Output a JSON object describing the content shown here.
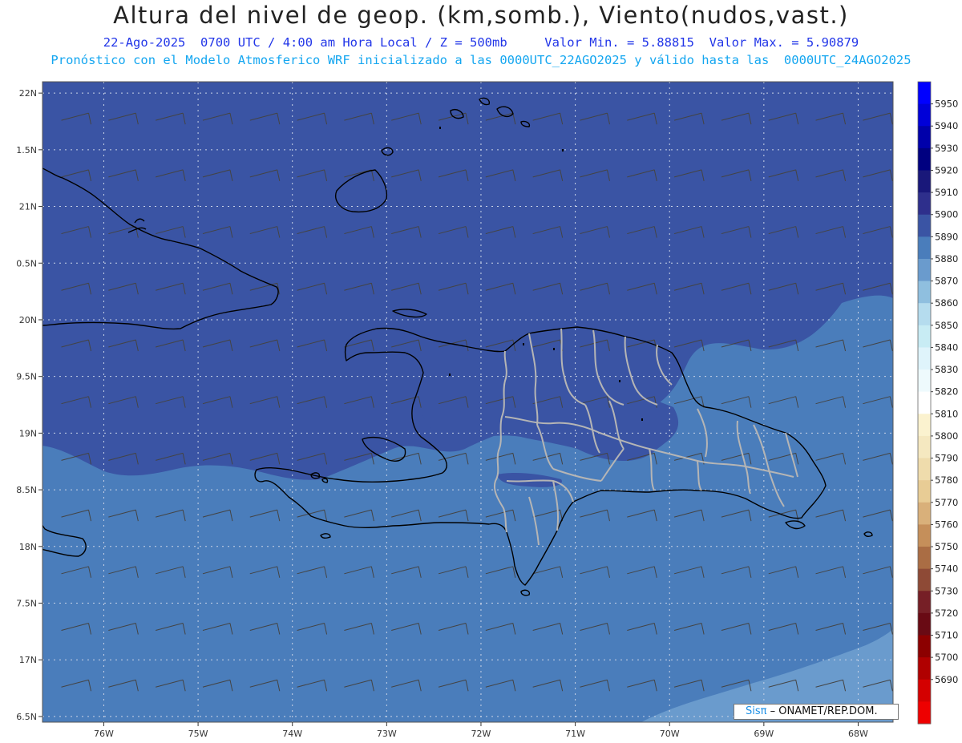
{
  "title": "Altura del nivel de geop. (km,somb.), Viento(nudos,vast.)",
  "subtitle_line1": "22-Ago-2025  0700 UTC / 4:00 am Hora Local / Z = 500mb     Valor Min. = 5.88815  Valor Max. = 5.90879",
  "subtitle_line2": "Pronóstico con el Modelo Atmosferico WRF inicializado a las 0000UTC_22AGO2025 y válido hasta las  0000UTC_24AGO2025",
  "credit": {
    "brand": "Sisπ",
    "text": " – ONAMET/REP.DOM."
  },
  "map": {
    "lon_range": [
      -76.65,
      -67.63
    ],
    "lat_range": [
      16.45,
      22.1
    ],
    "lat_ticks": [
      {
        "value": 22.0,
        "label": "22N"
      },
      {
        "value": 21.5,
        "label": "1.5N"
      },
      {
        "value": 21.0,
        "label": "21N"
      },
      {
        "value": 20.5,
        "label": "0.5N"
      },
      {
        "value": 20.0,
        "label": "20N"
      },
      {
        "value": 19.5,
        "label": "9.5N"
      },
      {
        "value": 19.0,
        "label": "19N"
      },
      {
        "value": 18.5,
        "label": "8.5N"
      },
      {
        "value": 18.0,
        "label": "18N"
      },
      {
        "value": 17.5,
        "label": "7.5N"
      },
      {
        "value": 17.0,
        "label": "17N"
      },
      {
        "value": 16.5,
        "label": "6.5N"
      }
    ],
    "lon_ticks": [
      {
        "value": -76,
        "label": "76W"
      },
      {
        "value": -75,
        "label": "75W"
      },
      {
        "value": -74,
        "label": "74W"
      },
      {
        "value": -73,
        "label": "73W"
      },
      {
        "value": -72,
        "label": "72W"
      },
      {
        "value": -71,
        "label": "71W"
      },
      {
        "value": -70,
        "label": "70W"
      },
      {
        "value": -69,
        "label": "69W"
      },
      {
        "value": -68,
        "label": "68W"
      }
    ],
    "gridlines": true,
    "shading_colors": {
      "5900": "#3a54a4",
      "5890": "#4a7dbb",
      "5880": "#6a9bcd"
    },
    "wind_barbs": {
      "color": "#444444",
      "lon_start": -76.45,
      "lon_step": 0.5,
      "lon_count": 18,
      "lat_start": 22.0,
      "lat_step": -0.5,
      "lat_count": 12,
      "direction_deg": 115,
      "speed_kt": 10
    }
  },
  "colorbar": {
    "labels": [
      "5950",
      "5940",
      "5930",
      "5920",
      "5910",
      "5900",
      "5890",
      "5880",
      "5870",
      "5860",
      "5850",
      "5840",
      "5830",
      "5820",
      "5810",
      "5800",
      "5790",
      "5780",
      "5770",
      "5760",
      "5750",
      "5740",
      "5730",
      "5720",
      "5710",
      "5700",
      "5690"
    ],
    "colors": [
      "#0000ff",
      "#0000d8",
      "#0000aa",
      "#000080",
      "#19187a",
      "#2e2f8c",
      "#3a54a4",
      "#4a7dbb",
      "#6a9bcd",
      "#8fbfdf",
      "#b5dcee",
      "#c8ecf4",
      "#dff4fb",
      "#eefafd",
      "#ffffff",
      "#fbf2cf",
      "#f5e8c0",
      "#efdcac",
      "#e8cc95",
      "#d9b07a",
      "#c58f5a",
      "#aa6d44",
      "#8e4a36",
      "#761f26",
      "#690a14",
      "#8c0000",
      "#b00000",
      "#d40000",
      "#ee0000"
    ]
  }
}
